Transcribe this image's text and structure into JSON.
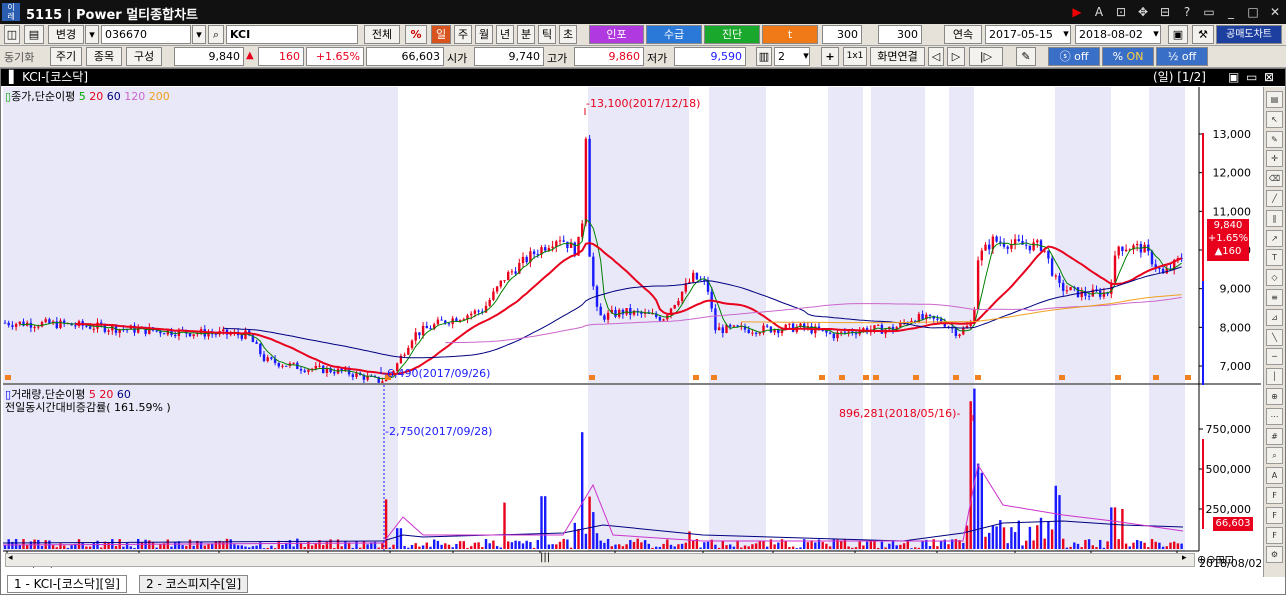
{
  "window": {
    "screen_no": "5115",
    "title": "Power 멀티종합차트"
  },
  "toolbar1": {
    "change": "변경",
    "code": "036670",
    "name": "KCI",
    "all": "전체",
    "pct": "%",
    "periods": [
      "일",
      "주",
      "월",
      "년",
      "분",
      "틱",
      "초"
    ],
    "btn_inpo": "인포",
    "btn_supply": "수급",
    "btn_diag": "진단",
    "btn_t": "t",
    "count1": "300",
    "count2": "300",
    "continuous": "연속",
    "date_from": "2017-05-15",
    "date_to": "2018-08-02",
    "short_chart": "공매도차트"
  },
  "toolbar2": {
    "sync": "동기화",
    "cycle": "주기",
    "item": "종목",
    "compose": "구성",
    "price": "9,840",
    "change": "160",
    "change_pct": "+1.65%",
    "volume": "66,603",
    "open_label": "시가",
    "open": "9,740",
    "high_label": "고가",
    "high": "9,860",
    "low_label": "저가",
    "low": "9,590",
    "layout_count": "2",
    "one_by_one": "1x1",
    "screen_link": "화면연결",
    "toggle_off1": "off",
    "toggle_on": "ON",
    "toggle_off2": "off"
  },
  "chart_header": {
    "title": "KCI-[코스닥]",
    "right": "(일) [1/2]"
  },
  "main_legend": {
    "label": "종가,단순이평",
    "ma": [
      "5",
      "20",
      "60",
      "120",
      "200"
    ]
  },
  "volume_legend": {
    "label": "거래량,단순이평",
    "ma": [
      "5",
      "20",
      "60"
    ],
    "line2": "전일동시간대비증감률( 161.59% )"
  },
  "price_annotations": {
    "high": "13,100(2017/12/18)",
    "low": "6,490(2017/09/26)"
  },
  "volume_annotations": {
    "high": "896,281(2018/05/16)",
    "low": "2,750(2017/09/28)"
  },
  "price_axis": [
    "13,000",
    "12,000",
    "11,000",
    "10,000",
    "9,000",
    "8,000",
    "7,000"
  ],
  "volume_axis": [
    "750,000",
    "500,000",
    "250,000"
  ],
  "price_tag": {
    "price": "9,840",
    "pct": "+1.65%",
    "chg": "▲160"
  },
  "volume_tag": "66,603",
  "x_axis": [
    "2017/05/15",
    "07",
    "08",
    "09",
    "10",
    "11",
    "12",
    "2018",
    "02",
    "03",
    "04",
    "05",
    "06",
    "07",
    "08"
  ],
  "x_end": "2018/08/02",
  "tabs": [
    "1 - KCI-[코스닥][일]",
    "2 - 코스피지수[일]"
  ],
  "colors": {
    "up": "#e8001c",
    "down": "#1a1aff",
    "shade": "#e8e8f8",
    "ma5": "#008000",
    "ma20": "#e8001c",
    "ma60": "#000080",
    "ma120": "#cc66cc",
    "ma200": "#f0a020"
  },
  "chart_data": {
    "type": "candlestick",
    "x_start": "2017-05-15",
    "x_end": "2018-08-02",
    "ylim": [
      6490,
      13100
    ],
    "high": 13100,
    "high_date": "2017-12-18",
    "low": 6490,
    "low_date": "2017-09-26",
    "close": 9840,
    "vol_max": 896281,
    "vol_max_date": "2018-05-16"
  }
}
